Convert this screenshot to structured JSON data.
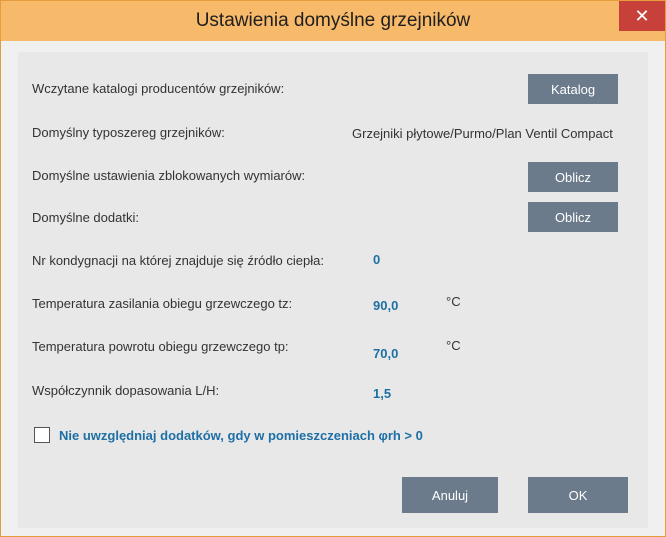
{
  "window": {
    "title": "Ustawienia domyślne grzejników",
    "close_symbol": "✕"
  },
  "rows": {
    "catalog_label": "Wczytane katalogi producentów grzejników:",
    "catalog_button": "Katalog",
    "series_label": "Domyślny typoszereg  grzejników:",
    "series_value": "Grzejniki płytowe/Purmo/Plan Ventil Compact",
    "blocked_label": "Domyślne ustawienia zblokowanych wymiarów:",
    "blocked_button": "Oblicz",
    "extras_label": "Domyślne dodatki:",
    "extras_button": "Oblicz",
    "floor_label": "Nr kondygnacji na której znajduje się źródło ciepła:",
    "floor_value": "0",
    "supply_label": "Temperatura zasilania obiegu grzewczego tz:",
    "supply_value": "90,0",
    "supply_unit": "°C",
    "return_label": "Temperatura powrotu obiegu grzewczego tp:",
    "return_value": "70,0",
    "return_unit": "°C",
    "ratio_label": "Współczynnik dopasowania L/H:",
    "ratio_value": "1,5"
  },
  "checkbox": {
    "label": "Nie uwzględniaj dodatków, gdy w pomieszczeniach φrh > 0",
    "checked": false
  },
  "footer": {
    "cancel_label": "Anuluj",
    "ok_label": "OK"
  },
  "colors": {
    "titlebar": "#f7b96a",
    "button": "#6b7b8c",
    "value": "#1d6fa5",
    "close": "#c7403a"
  }
}
